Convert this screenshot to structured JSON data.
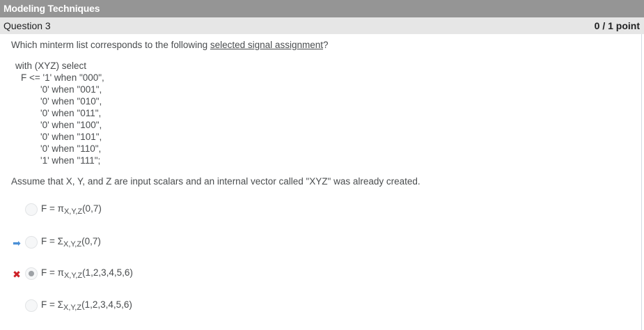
{
  "section": {
    "title": "Modeling Techniques"
  },
  "question": {
    "title": "Question 3",
    "score": "0 / 1 point",
    "prompt_before": "Which minterm list corresponds to the following ",
    "prompt_link": "selected signal assignment",
    "prompt_after": "?",
    "code_lines": [
      "with (XYZ) select",
      "F <= '1' when \"000\",",
      "'0' when \"001\",",
      "'0' when \"010\",",
      "'0' when \"011\",",
      "'0' when \"100\",",
      "'0' when \"101\",",
      "'0' when \"110\",",
      "'1' when \"111\";"
    ],
    "assumption": "Assume that X, Y, and Z are input scalars and an internal vector called \"XYZ\" was already created."
  },
  "options": [
    {
      "prefix": "F = ",
      "symbol": "π",
      "subscript": "X,Y,Z",
      "terms": "(0,7)",
      "selected": false,
      "marker": "none"
    },
    {
      "prefix": "F = ",
      "symbol": "Σ",
      "subscript": "X,Y,Z",
      "terms": "(0,7)",
      "selected": false,
      "marker": "correct-arrow"
    },
    {
      "prefix": "F = ",
      "symbol": "π",
      "subscript": "X,Y,Z",
      "terms": "(1,2,3,4,5,6)",
      "selected": true,
      "marker": "incorrect-x"
    },
    {
      "prefix": "F = ",
      "symbol": "Σ",
      "subscript": "X,Y,Z",
      "terms": "(1,2,3,4,5,6)",
      "selected": false,
      "marker": "none"
    }
  ],
  "icons": {
    "correct": "right-arrow-icon",
    "incorrect": "x-mark-icon"
  },
  "colors": {
    "section_bar": "#959595",
    "question_bar": "#e6e6e6",
    "arrow": "#4a8fd6",
    "x_mark": "#cd2026"
  }
}
